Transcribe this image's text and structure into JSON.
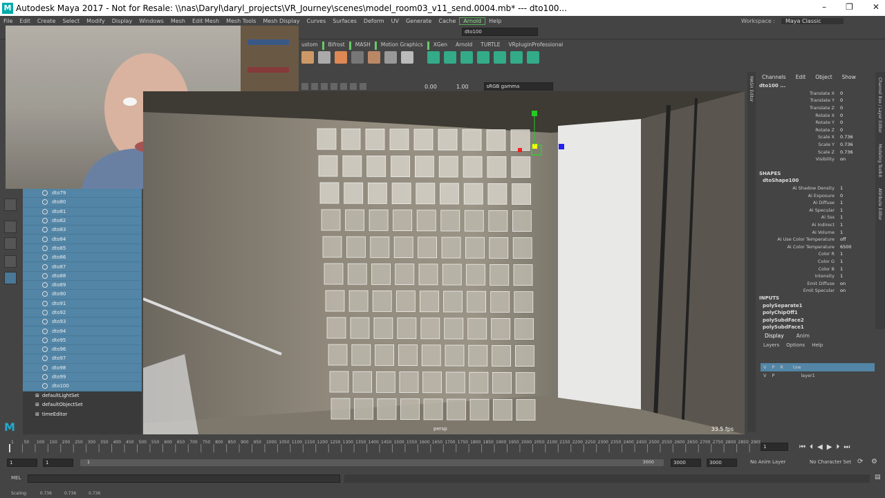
{
  "window": {
    "title": "Autodesk Maya 2017 - Not for Resale: \\\\nas\\Daryl\\daryl_projects\\VR_Journey\\scenes\\model_room03_v11_send.0004.mb*   ---   dto100...",
    "logo": "M",
    "minimize": "–",
    "maximize": "❐",
    "close": "✕"
  },
  "menu": [
    "File",
    "Edit",
    "Create",
    "Select",
    "Modify",
    "Display",
    "Windows",
    "Mesh",
    "Edit Mesh",
    "Mesh Tools",
    "Mesh Display",
    "Curves",
    "Surfaces",
    "Deform",
    "UV",
    "Generate",
    "Cache",
    "Arnold",
    "Help"
  ],
  "workspace": {
    "label": "Workspace :",
    "value": "Maya Classic"
  },
  "status": {
    "search_value": "dto100"
  },
  "shelf_tabs": [
    "ustom",
    "Bifrost",
    "MASH",
    "Motion Graphics",
    "XGen",
    "Arnold",
    "TURTLE",
    "VRpluginProfessional"
  ],
  "viewport": {
    "camera_label": "persp",
    "fps": "33.5 fps",
    "exposure": "0.00",
    "gamma": "1.00",
    "color_space": "sRGB gamma",
    "side_tab": "MASH Editor"
  },
  "outliner": {
    "items": [
      "dto79",
      "dto80",
      "dto81",
      "dto82",
      "dto83",
      "dto84",
      "dto85",
      "dto86",
      "dto87",
      "dto88",
      "dto89",
      "dto90",
      "dto91",
      "dto92",
      "dto93",
      "dto94",
      "dto95",
      "dto96",
      "dto97",
      "dto98",
      "dto99",
      "dto100"
    ],
    "sets": [
      "defaultLightSet",
      "defaultObjectSet",
      "timeEditor"
    ]
  },
  "channel_box": {
    "menus": [
      "Channels",
      "Edit",
      "Object",
      "Show"
    ],
    "object": "dto100 ...",
    "transform": [
      {
        "k": "Translate X",
        "v": "0"
      },
      {
        "k": "Translate Y",
        "v": "0"
      },
      {
        "k": "Translate Z",
        "v": "0"
      },
      {
        "k": "Rotate X",
        "v": "0"
      },
      {
        "k": "Rotate Y",
        "v": "0"
      },
      {
        "k": "Rotate Z",
        "v": "0"
      },
      {
        "k": "Scale X",
        "v": "0.736"
      },
      {
        "k": "Scale Y",
        "v": "0.736"
      },
      {
        "k": "Scale Z",
        "v": "0.736"
      },
      {
        "k": "Visibility",
        "v": "on"
      }
    ],
    "shapes_label": "SHAPES",
    "shape_name": "dtoShape100",
    "shape_attrs": [
      {
        "k": "Ai Shadow Density",
        "v": "1"
      },
      {
        "k": "Ai Exposure",
        "v": "0"
      },
      {
        "k": "Ai Diffuse",
        "v": "1"
      },
      {
        "k": "Ai Specular",
        "v": "1"
      },
      {
        "k": "Ai Sss",
        "v": "1"
      },
      {
        "k": "Ai Indirect",
        "v": "1"
      },
      {
        "k": "Ai Volume",
        "v": "1"
      },
      {
        "k": "Ai Use Color Temperature",
        "v": "off"
      },
      {
        "k": "Ai Color Temperature",
        "v": "6500"
      },
      {
        "k": "Color R",
        "v": "1"
      },
      {
        "k": "Color G",
        "v": "1"
      },
      {
        "k": "Color B",
        "v": "1"
      },
      {
        "k": "Intensity",
        "v": "1"
      },
      {
        "k": "Emit Diffuse",
        "v": "on"
      },
      {
        "k": "Emit Specular",
        "v": "on"
      }
    ],
    "inputs_label": "INPUTS",
    "inputs": [
      "polySeparate1",
      "polyChipOff1",
      "polySubdFace2",
      "polySubdFace1"
    ],
    "side_tabs": [
      "Channel Box / Layer Editor",
      "Modeling Toolkit",
      "Attribute Editor"
    ]
  },
  "layer_editor": {
    "tabs": [
      "Display",
      "Anim"
    ],
    "menus": [
      "Layers",
      "Options",
      "Help"
    ],
    "layers": [
      {
        "v": "V",
        "p": "P",
        "r": "R",
        "name": "tow"
      },
      {
        "v": "V",
        "p": "P",
        "r": "",
        "name": "layer1"
      }
    ]
  },
  "timeline": {
    "ticks": [
      "1",
      "50",
      "100",
      "150",
      "200",
      "250",
      "300",
      "350",
      "400",
      "450",
      "500",
      "550",
      "600",
      "650",
      "700",
      "750",
      "800",
      "850",
      "900",
      "950",
      "1000",
      "1050",
      "1100",
      "1150",
      "1200",
      "1250",
      "1300",
      "1350",
      "1400",
      "1450",
      "1500",
      "1550",
      "1600",
      "1650",
      "1700",
      "1750",
      "1800",
      "1850",
      "1900",
      "1950",
      "2000",
      "2050",
      "2100",
      "2150",
      "2200",
      "2250",
      "2300",
      "2350",
      "2400",
      "2450",
      "2500",
      "2550",
      "2600",
      "2650",
      "2700",
      "2750",
      "2800",
      "2850",
      "2900"
    ],
    "current_frame": "1"
  },
  "range": {
    "start": "1",
    "start_inner": "1",
    "slider_start": "1",
    "slider_end": "3000",
    "end_inner": "3000",
    "end": "3000",
    "anim_layer": "No Anim Layer",
    "char_set": "No Character Set"
  },
  "mel": {
    "label": "MEL"
  },
  "help_line": {
    "label": "Scaling:",
    "values": [
      "0.736",
      "0.736",
      "0.736"
    ]
  },
  "colors": {
    "ui_bg": "#444444",
    "select_blue": "#5285a6",
    "shelf_green": "#55aa66"
  }
}
